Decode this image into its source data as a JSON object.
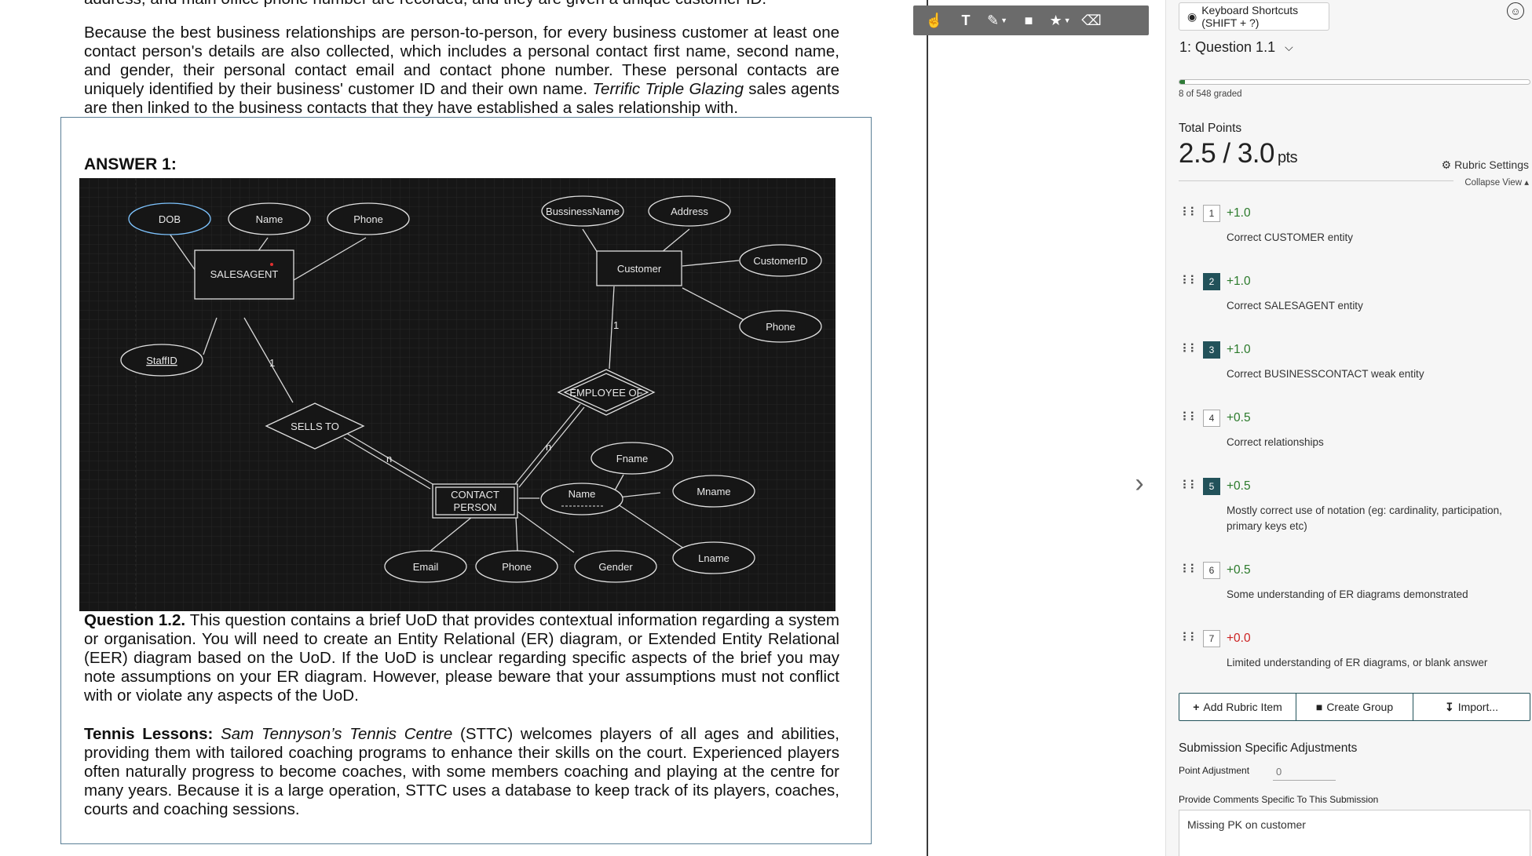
{
  "document": {
    "top_cut_line": "address, and main office phone number are recorded, and they are given a unique customer ID.",
    "paragraph1_a": "Because the best business relationships are person-to-person, for every business customer at least one contact person's details are also collected, which includes a personal contact first name, second name, and gender, their personal contact email and contact phone number. These personal contacts are uniquely identified by their business' customer ID and their own name. ",
    "paragraph1_italic": "Terrific Triple Glazing",
    "paragraph1_b": " sales agents are then linked to the business contacts that they have established a sales relationship with.",
    "answer_label": "ANSWER 1:",
    "q12_heading": "Question 1.2.",
    "q12_text": " This question contains a brief UoD that provides contextual information regarding a system or organisation. You will need to create an Entity Relational (ER) diagram, or Extended Entity Relational (EER) diagram based on the UoD. If the UoD is unclear regarding specific aspects of the brief you may note assumptions on your ER diagram. However, please beware that your assumptions must not conflict with or violate any aspects of the UoD.",
    "tennis_heading": "Tennis Lessons:",
    "tennis_italic": "Sam Tennyson’s Tennis Centre",
    "tennis_text": " (STTC) welcomes players of all ages and abilities, providing them with tailored coaching programs to enhance their skills on the court. Experienced players often naturally progress to become coaches, with some members coaching and playing at the centre for many years.  Because it is a large operation, STTC uses a database to keep track of its players, coaches, courts and coaching sessions."
  },
  "er_diagram": {
    "entities": {
      "salesagent": "SALESAGENT",
      "customer": "Customer",
      "contact_person_1": "CONTACT",
      "contact_person_2": "PERSON"
    },
    "attributes": {
      "dob": "DOB",
      "name": "Name",
      "phone_sa": "Phone",
      "staffid": "StaffID",
      "business_name": "BussinessName",
      "address": "Address",
      "customer_id": "CustomerID",
      "phone_cust": "Phone",
      "fname": "Fname",
      "cp_name": "Name",
      "mname": "Mname",
      "lname": "Lname",
      "email": "Email",
      "phone_cp": "Phone",
      "gender": "Gender"
    },
    "relationships": {
      "sells_to": "SELLS TO",
      "employee_of": "EMPLOYEE OF"
    },
    "cardinalities": {
      "c1": "1",
      "c2": "1",
      "cn1": "n",
      "cn2": "n"
    }
  },
  "toolbar": {
    "tools": [
      "select-tool",
      "text-tool",
      "pen-tool",
      "box-tool",
      "stamp-tool",
      "eraser-tool"
    ]
  },
  "panel": {
    "shortcuts_label": "Keyboard Shortcuts (SHIFT + ?)",
    "question_label": "1: Question 1.1",
    "progress_fraction": 0.0146,
    "graded_text": "8 of 548 graded",
    "total_points_label": "Total Points",
    "score": "2.5 / 3.0",
    "score_unit": "pts",
    "rubric_settings_label": "Rubric Settings",
    "collapse_view_label": "Collapse View",
    "rubric_items": [
      {
        "num": "1",
        "points": "+1.0",
        "desc": "Correct CUSTOMER entity",
        "selected": false
      },
      {
        "num": "2",
        "points": "+1.0",
        "desc": "Correct SALESAGENT entity",
        "selected": true
      },
      {
        "num": "3",
        "points": "+1.0",
        "desc": "Correct BUSINESSCONTACT weak entity",
        "selected": true
      },
      {
        "num": "4",
        "points": "+0.5",
        "desc": "Correct relationships",
        "selected": false
      },
      {
        "num": "5",
        "points": "+0.5",
        "desc": "Mostly correct use of notation (eg: cardinality, participation, primary keys etc)",
        "selected": true
      },
      {
        "num": "6",
        "points": "+0.5",
        "desc": "Some understanding of ER diagrams demonstrated",
        "selected": false
      },
      {
        "num": "7",
        "points": "+0.0",
        "desc": "Limited understanding of ER diagrams, or blank answer",
        "selected": false
      }
    ],
    "add_rubric_label": "Add Rubric Item",
    "create_group_label": "Create Group",
    "import_label": "Import...",
    "ssa_title": "Submission Specific Adjustments",
    "point_adjustment_label": "Point Adjustment",
    "point_adjustment_placeholder": "0",
    "comments_label": "Provide Comments Specific To This Submission",
    "comments_value": "Missing PK on customer"
  },
  "colors": {
    "accent": "#22525a",
    "positive": "#2b7a2b",
    "zero": "#cc2222",
    "diagram_bg": "#161616"
  }
}
